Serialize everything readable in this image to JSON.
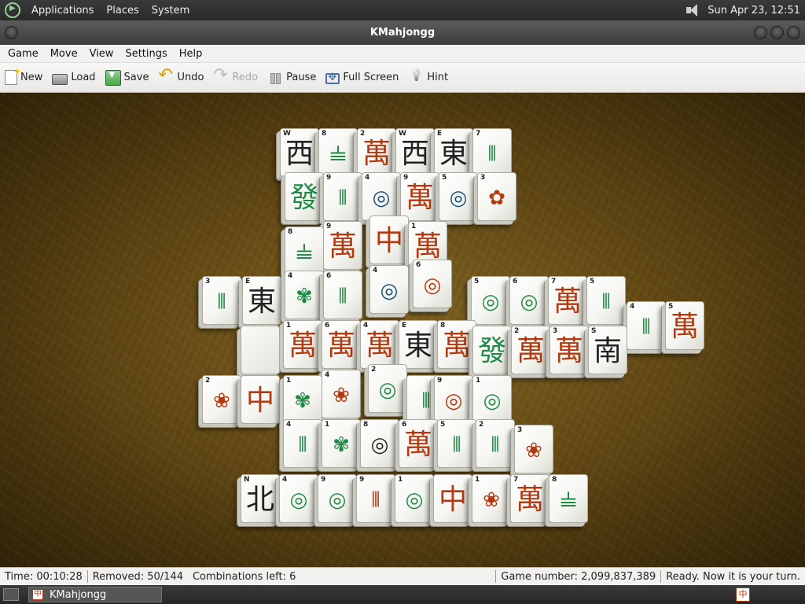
{
  "top_panel": {
    "menus": [
      "Applications",
      "Places",
      "System"
    ],
    "clock": "Sun Apr 23, 12:51"
  },
  "window": {
    "title": "KMahjongg"
  },
  "menubar": [
    "Game",
    "Move",
    "View",
    "Settings",
    "Help"
  ],
  "toolbar": {
    "new": "New",
    "load": "Load",
    "save": "Save",
    "undo": "Undo",
    "redo": "Redo",
    "pause": "Pause",
    "fullscreen": "Full Screen",
    "hint": "Hint"
  },
  "tiles": [
    {
      "glyph": "西",
      "idx": "W",
      "color": "black"
    },
    {
      "glyph": "𝍧",
      "idx": "8",
      "color": "green"
    },
    {
      "glyph": "萬",
      "idx": "2",
      "color": "red"
    },
    {
      "glyph": "西",
      "idx": "W",
      "color": "black"
    },
    {
      "glyph": "東",
      "idx": "E",
      "color": "black"
    },
    {
      "glyph": "⦀",
      "idx": "7",
      "color": "green"
    },
    {
      "glyph": "發",
      "idx": "",
      "color": "green"
    },
    {
      "glyph": "⦀",
      "idx": "9",
      "color": "green"
    },
    {
      "glyph": "◎",
      "idx": "4",
      "color": "blue"
    },
    {
      "glyph": "萬",
      "idx": "9",
      "color": "red"
    },
    {
      "glyph": "◎",
      "idx": "5",
      "color": "blue"
    },
    {
      "glyph": "✿",
      "idx": "3",
      "color": "red"
    },
    {
      "glyph": "𝍧",
      "idx": "8",
      "color": "green"
    },
    {
      "glyph": "萬",
      "idx": "9",
      "color": "red"
    },
    {
      "glyph": "中",
      "idx": "",
      "color": "red"
    },
    {
      "glyph": "萬",
      "idx": "1",
      "color": "red"
    },
    {
      "glyph": "◎",
      "idx": "4",
      "color": "blue"
    },
    {
      "glyph": "◎",
      "idx": "6",
      "color": "red"
    },
    {
      "glyph": "⦀",
      "idx": "3",
      "color": "green"
    },
    {
      "glyph": "東",
      "idx": "E",
      "color": "black"
    },
    {
      "glyph": "✾",
      "idx": "4",
      "color": "green"
    },
    {
      "glyph": "⦀",
      "idx": "6",
      "color": "green"
    },
    {
      "glyph": "◎",
      "idx": "5",
      "color": "green"
    },
    {
      "glyph": "◎",
      "idx": "6",
      "color": "green"
    },
    {
      "glyph": "萬",
      "idx": "7",
      "color": "red"
    },
    {
      "glyph": "⦀",
      "idx": "5",
      "color": "green"
    },
    {
      "glyph": "⦀",
      "idx": "4",
      "color": "green"
    },
    {
      "glyph": "萬",
      "idx": "5",
      "color": "red"
    },
    {
      "glyph": "",
      "idx": "",
      "color": "black"
    },
    {
      "glyph": "萬",
      "idx": "1",
      "color": "red"
    },
    {
      "glyph": "萬",
      "idx": "6",
      "color": "red"
    },
    {
      "glyph": "萬",
      "idx": "4",
      "color": "red"
    },
    {
      "glyph": "東",
      "idx": "E",
      "color": "black"
    },
    {
      "glyph": "萬",
      "idx": "8",
      "color": "red"
    },
    {
      "glyph": "發",
      "idx": "",
      "color": "green"
    },
    {
      "glyph": "萬",
      "idx": "2",
      "color": "red"
    },
    {
      "glyph": "萬",
      "idx": "3",
      "color": "red"
    },
    {
      "glyph": "南",
      "idx": "S",
      "color": "black"
    },
    {
      "glyph": "❀",
      "idx": "2",
      "color": "red"
    },
    {
      "glyph": "中",
      "idx": "",
      "color": "red"
    },
    {
      "glyph": "✾",
      "idx": "1",
      "color": "green"
    },
    {
      "glyph": "❀",
      "idx": "4",
      "color": "red"
    },
    {
      "glyph": "◎",
      "idx": "2",
      "color": "green"
    },
    {
      "glyph": "⦀",
      "idx": "",
      "color": "green"
    },
    {
      "glyph": "◎",
      "idx": "9",
      "color": "red"
    },
    {
      "glyph": "◎",
      "idx": "1",
      "color": "green"
    },
    {
      "glyph": "⦀",
      "idx": "4",
      "color": "green"
    },
    {
      "glyph": "✾",
      "idx": "1",
      "color": "green"
    },
    {
      "glyph": "◎",
      "idx": "8",
      "color": "black"
    },
    {
      "glyph": "萬",
      "idx": "6",
      "color": "red"
    },
    {
      "glyph": "⦀",
      "idx": "5",
      "color": "green"
    },
    {
      "glyph": "⦀",
      "idx": "2",
      "color": "green"
    },
    {
      "glyph": "❀",
      "idx": "3",
      "color": "red"
    },
    {
      "glyph": "北",
      "idx": "N",
      "color": "black"
    },
    {
      "glyph": "◎",
      "idx": "4",
      "color": "green"
    },
    {
      "glyph": "◎",
      "idx": "9",
      "color": "green"
    },
    {
      "glyph": "⦀",
      "idx": "9",
      "color": "red"
    },
    {
      "glyph": "◎",
      "idx": "1",
      "color": "green"
    },
    {
      "glyph": "中",
      "idx": "",
      "color": "red"
    },
    {
      "glyph": "❀",
      "idx": "1",
      "color": "red"
    },
    {
      "glyph": "萬",
      "idx": "7",
      "color": "red"
    },
    {
      "glyph": "𝍧",
      "idx": "8",
      "color": "green"
    }
  ],
  "statusbar": {
    "time": "Time: 00:10:28",
    "removed": "Removed: 50/144",
    "combinations": "Combinations left: 6",
    "game_number": "Game number: 2,099,837,389",
    "status": "Ready. Now it is your turn."
  },
  "taskbar": {
    "task_label": "KMahjongg"
  }
}
